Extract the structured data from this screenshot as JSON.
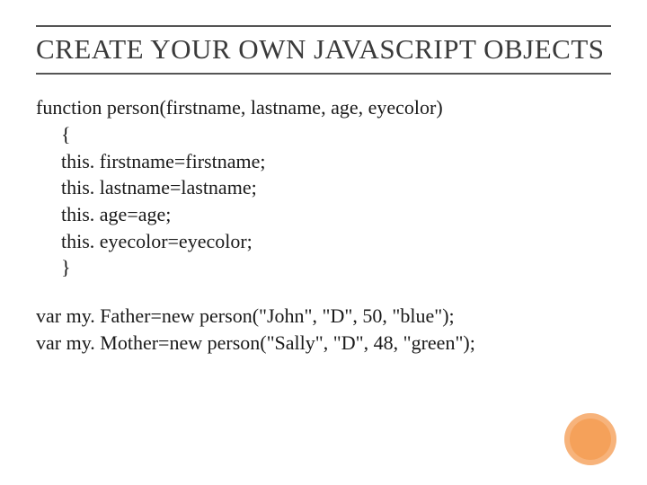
{
  "title": "CREATE YOUR OWN JAVASCRIPT OBJECTS",
  "code": {
    "l1": "function person(firstname, lastname, age, eyecolor)",
    "l2": "{",
    "l3": "this. firstname=firstname;",
    "l4": "this. lastname=lastname;",
    "l5": "this. age=age;",
    "l6": "this. eyecolor=eyecolor;",
    "l7": "}",
    "l8": "var my. Father=new person(\"John\", \"D\", 50, \"blue\");",
    "l9": "var my. Mother=new person(\"Sally\", \"D\", 48, \"green\");"
  }
}
